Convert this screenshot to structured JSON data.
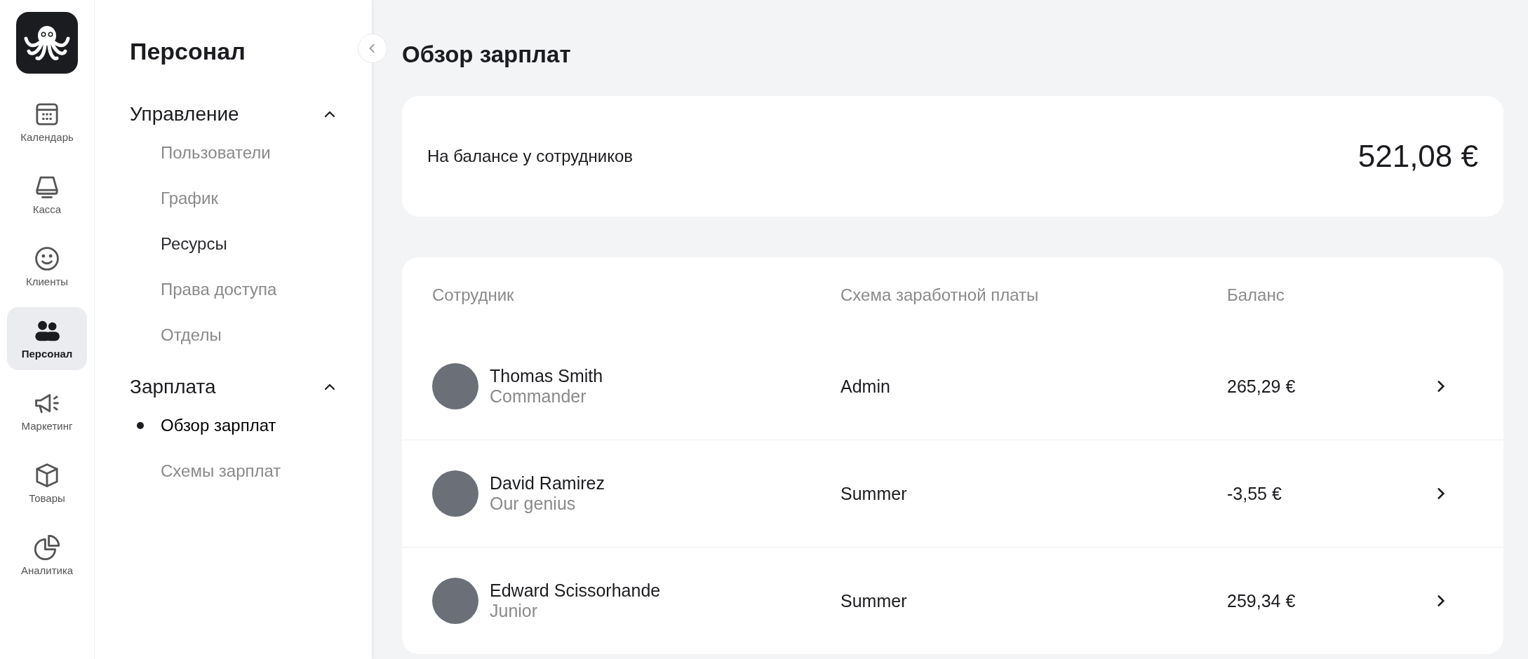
{
  "rail": {
    "items": [
      {
        "label": "Календарь",
        "selected": false
      },
      {
        "label": "Касса",
        "selected": false
      },
      {
        "label": "Клиенты",
        "selected": false
      },
      {
        "label": "Персонал",
        "selected": true
      },
      {
        "label": "Маркетинг",
        "selected": false
      },
      {
        "label": "Товары",
        "selected": false
      },
      {
        "label": "Аналитика",
        "selected": false
      }
    ]
  },
  "subnav": {
    "title": "Персонал",
    "groups": [
      {
        "label": "Управление",
        "expanded": true,
        "items": [
          {
            "label": "Пользователи",
            "selected": false,
            "hovered": false
          },
          {
            "label": "График",
            "selected": false,
            "hovered": false
          },
          {
            "label": "Ресурсы",
            "selected": false,
            "hovered": true
          },
          {
            "label": "Права доступа",
            "selected": false,
            "hovered": false
          },
          {
            "label": "Отделы",
            "selected": false,
            "hovered": false
          }
        ]
      },
      {
        "label": "Зарплата",
        "expanded": true,
        "items": [
          {
            "label": "Обзор зарплат",
            "selected": true,
            "hovered": false
          },
          {
            "label": "Схемы зарплат",
            "selected": false,
            "hovered": false
          }
        ]
      }
    ]
  },
  "page": {
    "title": "Обзор зарплат"
  },
  "balance_card": {
    "label": "На балансе у сотрудников",
    "amount": "521,08 €"
  },
  "table": {
    "columns": [
      "Сотрудник",
      "Схема заработной платы",
      "Баланс"
    ],
    "rows": [
      {
        "name": "Thomas Smith",
        "role": "Commander",
        "scheme": "Admin",
        "balance": "265,29 €"
      },
      {
        "name": "David Ramirez",
        "role": "Our genius",
        "scheme": "Summer",
        "balance": "-3,55 €"
      },
      {
        "name": "Edward Scissorhande",
        "role": "Junior",
        "scheme": "Summer",
        "balance": "259,34 €"
      }
    ]
  }
}
